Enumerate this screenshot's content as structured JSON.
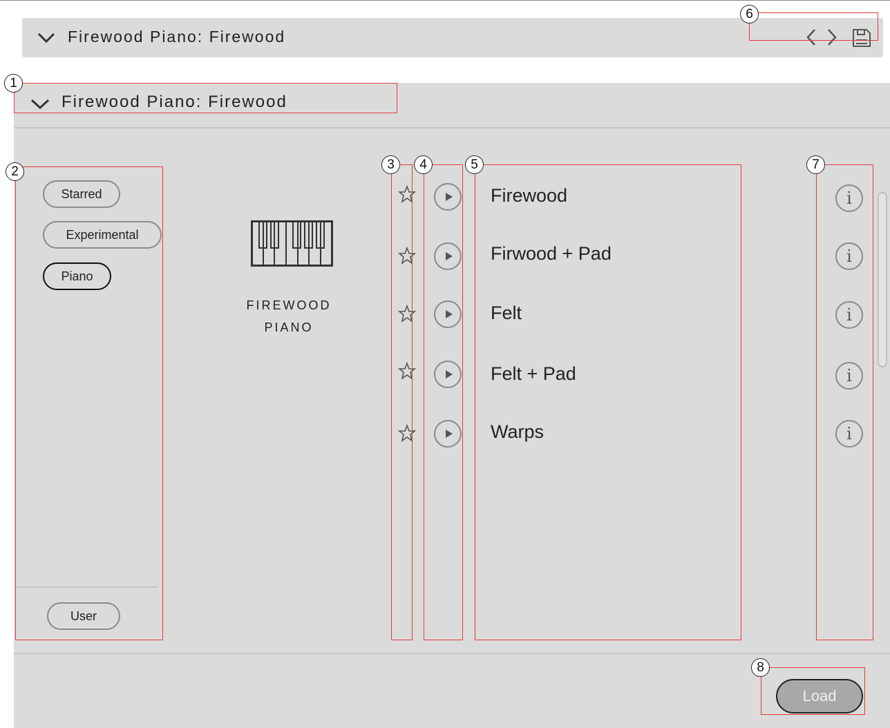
{
  "header": {
    "title": "Firewood Piano: Firewood",
    "icons": [
      "chevron-down-icon",
      "chevron-left-icon",
      "chevron-right-icon",
      "save-icon"
    ]
  },
  "panel": {
    "title": "Firewood Piano: Firewood"
  },
  "tags": [
    {
      "label": "Starred",
      "active": false
    },
    {
      "label": "Experimental",
      "active": false
    },
    {
      "label": "Piano",
      "active": true
    }
  ],
  "user_tag": {
    "label": "User"
  },
  "instrument": {
    "line1": "FIREWOOD",
    "line2": "PIANO",
    "icon": "piano-keys-icon"
  },
  "presets": [
    {
      "name": "Firewood"
    },
    {
      "name": "Firwood + Pad"
    },
    {
      "name": "Felt"
    },
    {
      "name": "Felt + Pad"
    },
    {
      "name": "Warps"
    }
  ],
  "load_button": {
    "label": "Load"
  },
  "annotations": [
    "1",
    "2",
    "3",
    "4",
    "5",
    "6",
    "7",
    "8"
  ],
  "colors": {
    "panel_bg": "#dcdbdb",
    "annotation_red": "#e23c3c",
    "load_bg": "#a8a8a8"
  }
}
